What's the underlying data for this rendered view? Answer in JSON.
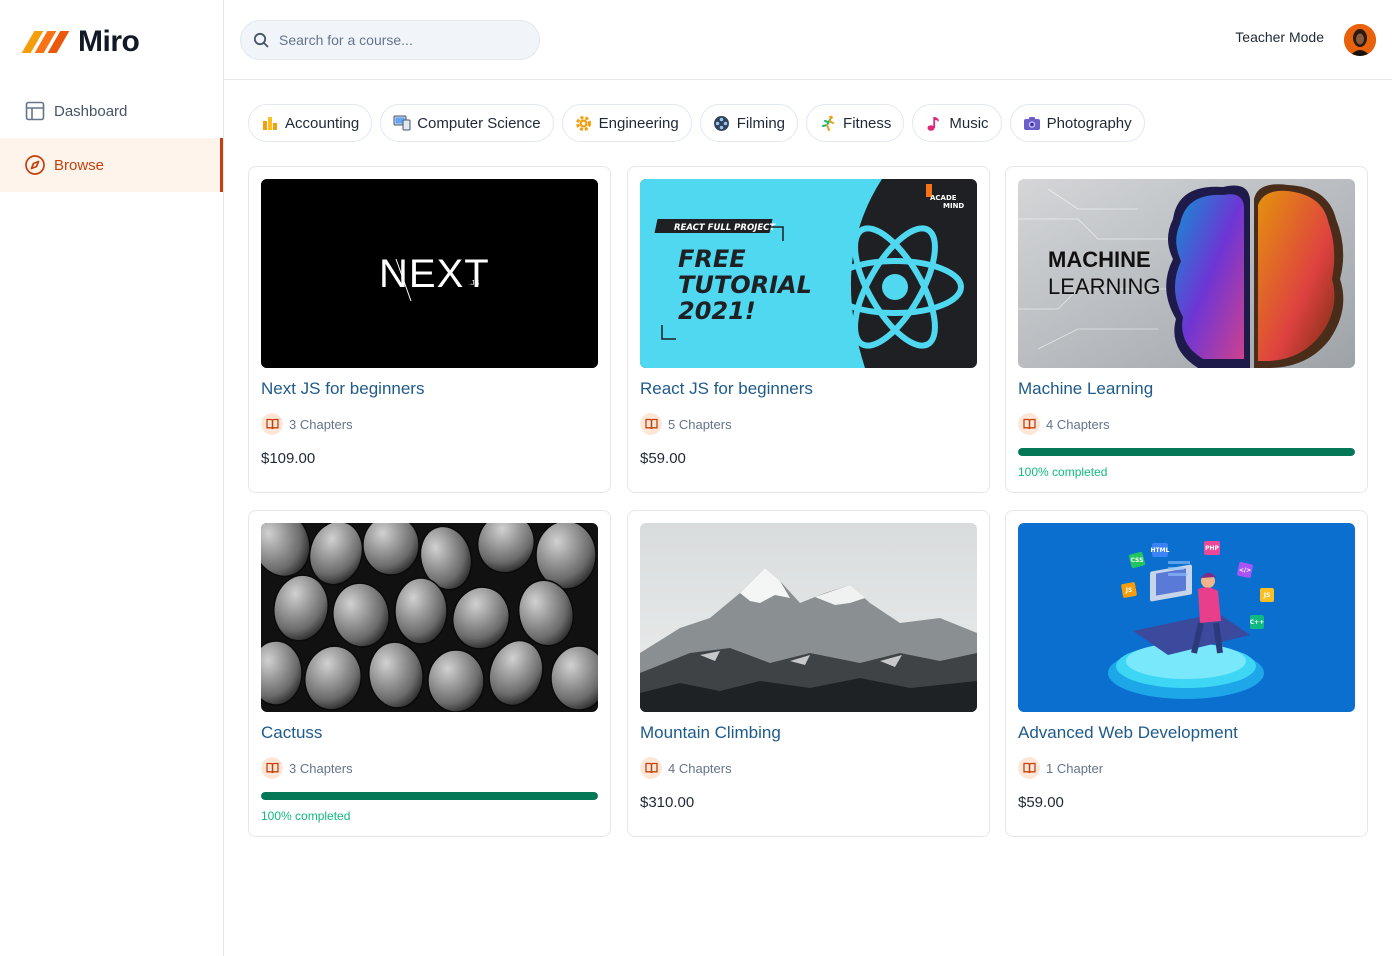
{
  "app": {
    "name": "Miro"
  },
  "sidebar": {
    "items": [
      {
        "label": "Dashboard",
        "icon": "layout-icon"
      },
      {
        "label": "Browse",
        "icon": "compass-icon",
        "active": true
      }
    ]
  },
  "header": {
    "search_placeholder": "Search for a course...",
    "teacher_mode": "Teacher Mode"
  },
  "categories": [
    {
      "label": "Accounting",
      "icon": "bar-chart-emoji"
    },
    {
      "label": "Computer Science",
      "icon": "computer-emoji"
    },
    {
      "label": "Engineering",
      "icon": "gear-emoji"
    },
    {
      "label": "Filming",
      "icon": "film-reel-emoji"
    },
    {
      "label": "Fitness",
      "icon": "runner-emoji"
    },
    {
      "label": "Music",
      "icon": "music-note-emoji"
    },
    {
      "label": "Photography",
      "icon": "camera-emoji"
    }
  ],
  "thumb_text": {
    "next": {
      "brand": "NEXT",
      "suffix": ".JS"
    },
    "react": {
      "badge": "REACT FULL PROJECT",
      "line1": "FREE",
      "line2": "TUTORIAL",
      "line3": "2021!",
      "brand1": "ACADE",
      "brand2": "MIND"
    },
    "ml": {
      "line1": "MACHINE",
      "line2": "LEARNING"
    },
    "web": {
      "tags": [
        "CSS",
        "HTML",
        "JS",
        "PHP",
        "</>",
        "C++",
        "JS"
      ]
    }
  },
  "courses": [
    {
      "title": "Next JS for beginners",
      "chapters": "3 Chapters",
      "price": "$109.00"
    },
    {
      "title": "React JS for beginners",
      "chapters": "5 Chapters",
      "price": "$59.00"
    },
    {
      "title": "Machine Learning",
      "chapters": "4 Chapters",
      "progress": 100,
      "progress_label": "100% completed"
    },
    {
      "title": "Cactuss",
      "chapters": "3 Chapters",
      "progress": 100,
      "progress_label": "100% completed"
    },
    {
      "title": "Mountain Climbing",
      "chapters": "4 Chapters",
      "price": "$310.00"
    },
    {
      "title": "Advanced Web Development",
      "chapters": "1 Chapter",
      "price": "$59.00"
    }
  ],
  "colors": {
    "brand_orange": "#c2410c",
    "link_blue": "#1e5a8a",
    "progress_green": "#047857"
  }
}
